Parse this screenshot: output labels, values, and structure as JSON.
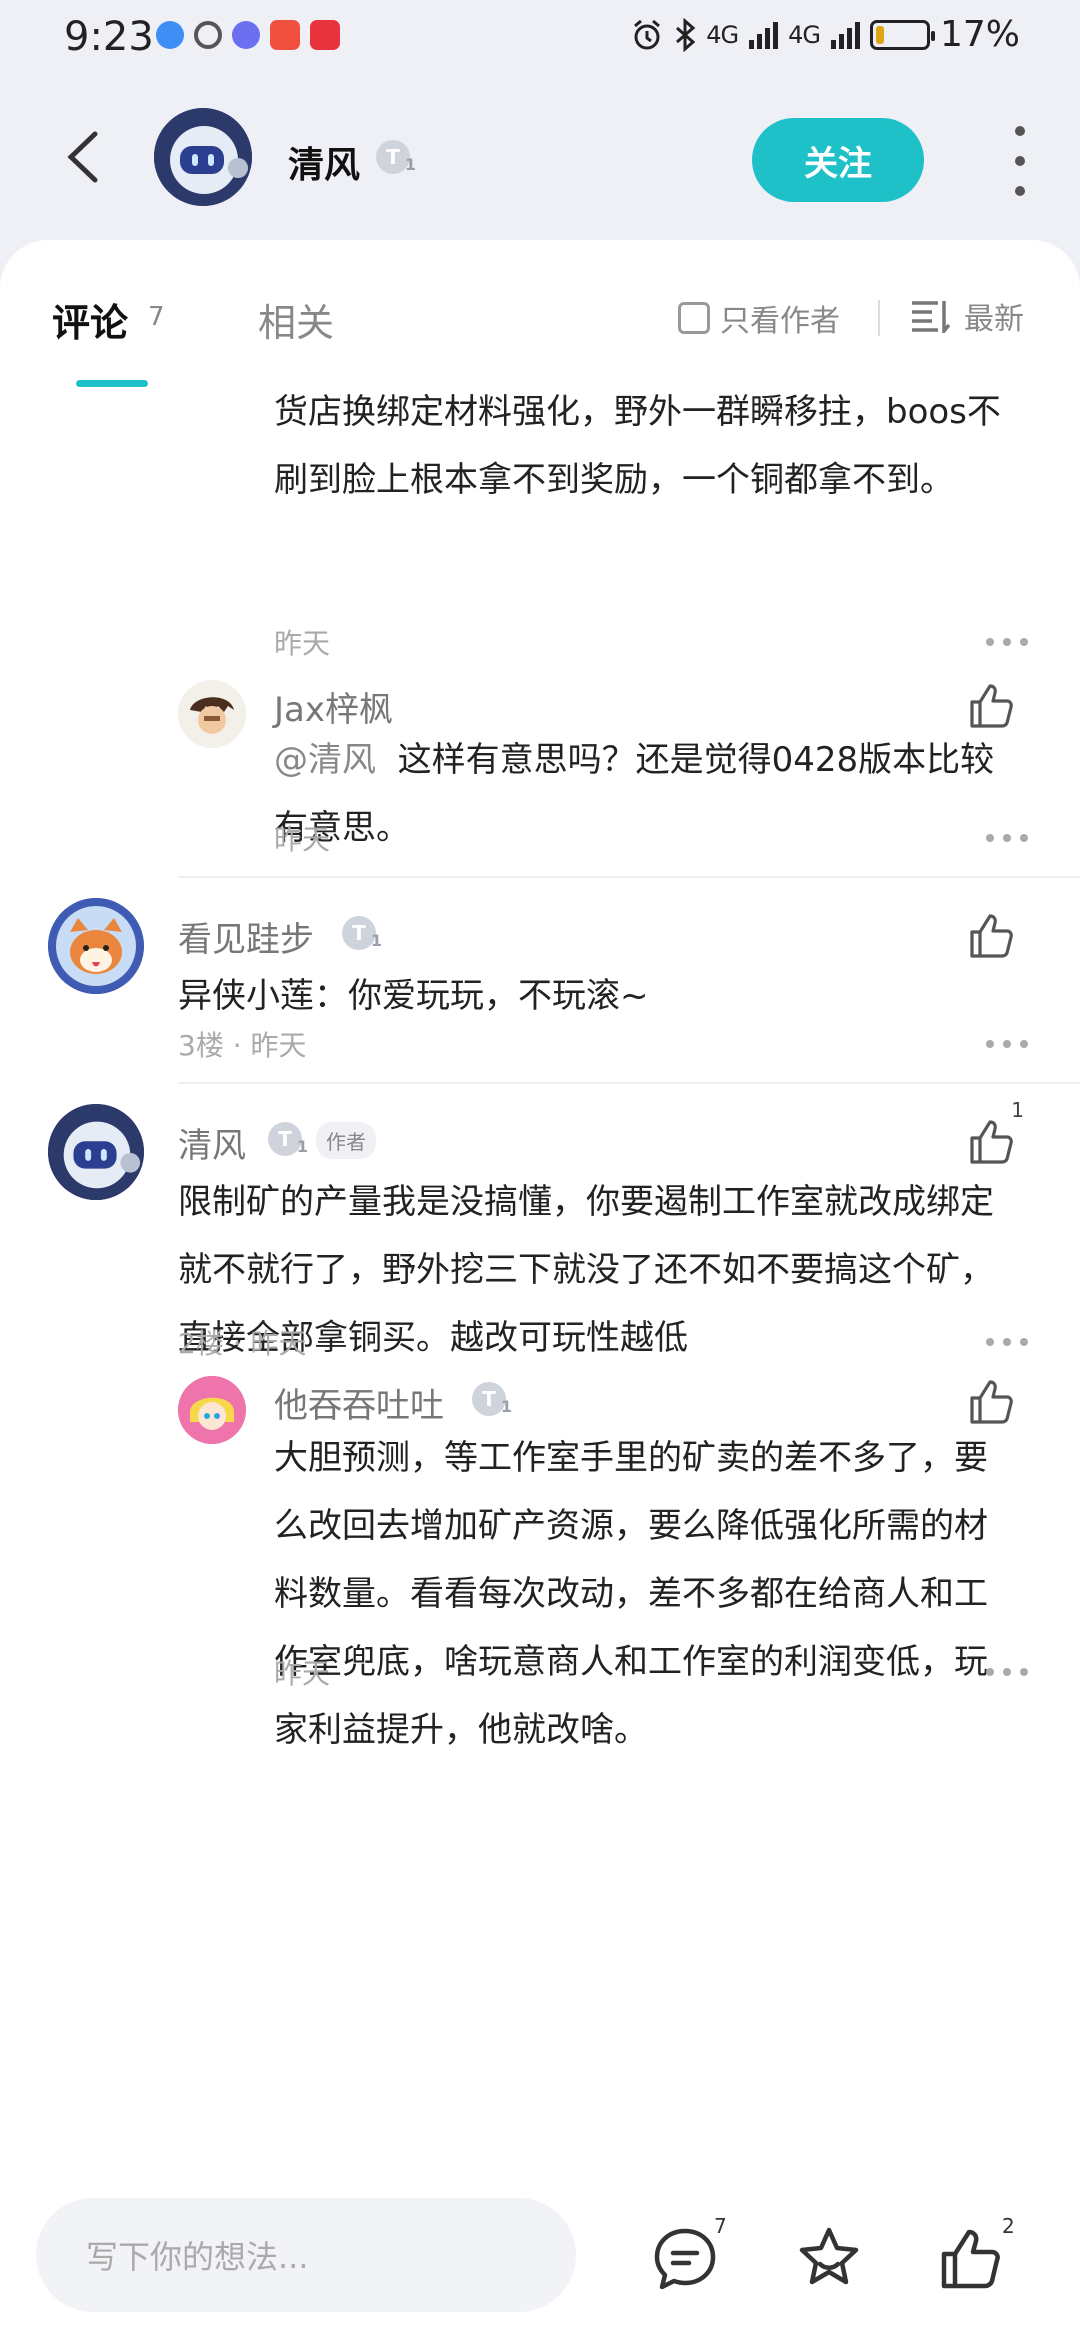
{
  "status": {
    "time": "9:23",
    "signal1": "4G",
    "signal2": "4G",
    "battery": "17%",
    "battery_level": 0.17
  },
  "header": {
    "name": "清风",
    "level": "T",
    "level_sub": "1",
    "follow_label": "关注"
  },
  "tabs": {
    "comments_label": "评论",
    "comments_count": "7",
    "related_label": "相关",
    "author_only_label": "只看作者",
    "sort_label": "最新"
  },
  "comments": {
    "c1_text": "货店换绑定材料强化，野外一群瞬移拄，boos不刷到脸上根本拿不到奖励，一个铜都拿不到。",
    "c1_meta": "昨天",
    "r1": {
      "name": "Jax梓枫",
      "mention": "@清风",
      "text": "这样有意思吗？还是觉得0428版本比较有意思。",
      "meta": "昨天"
    },
    "f3": {
      "name": "看见跬步",
      "level": "T",
      "level_sub": "1",
      "text": "异侠小莲：你爱玩玩，不玩滚~",
      "meta": "3楼 · 昨天"
    },
    "f2": {
      "name": "清风",
      "level": "T",
      "level_sub": "1",
      "author_tag": "作者",
      "likes": "1",
      "text": "限制矿的产量我是没搞懂，你要遏制工作室就改成绑定就不就行了，野外挖三下就没了还不如不要搞这个矿，直接全部拿铜买。越改可玩性越低",
      "meta": "2楼 · 昨天"
    },
    "r2": {
      "name": "他吞吞吐吐",
      "level": "T",
      "level_sub": "1",
      "text": "大胆预测，等工作室手里的矿卖的差不多了，要么改回去增加矿产资源，要么降低强化所需的材料数量。看看每次改动，差不多都在给商人和工作室兜底，啥玩意商人和工作室的利润变低，玩家利益提升，他就改啥。",
      "meta": "昨天"
    }
  },
  "bottom": {
    "input_placeholder": "写下你的想法...",
    "comment_count": "7",
    "like_count": "2"
  },
  "colors": {
    "accent": "#1fc1c9",
    "sheet": "#ffffff",
    "bg": "#eef0f5"
  }
}
